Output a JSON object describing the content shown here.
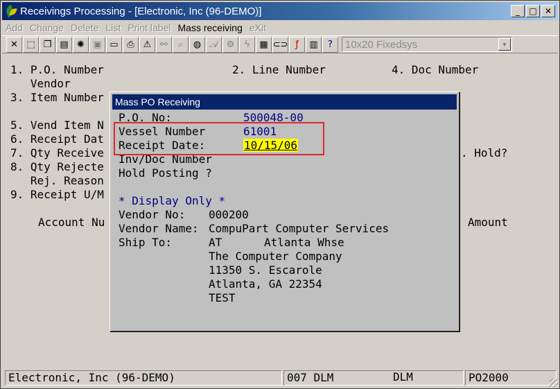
{
  "window": {
    "title": "Receivings Processing - [Electronic, Inc (96-DEMO)]",
    "buttons": {
      "minimize": "_",
      "maximize": "□",
      "close": "✕"
    }
  },
  "menu": {
    "items": [
      {
        "label": "Add",
        "enabled": false
      },
      {
        "label": "Change",
        "enabled": false
      },
      {
        "label": "Delete",
        "enabled": false
      },
      {
        "label": "List",
        "enabled": false
      },
      {
        "label": "Print label",
        "enabled": false
      },
      {
        "label": "Mass receiving",
        "enabled": true
      },
      {
        "label": "eXit",
        "enabled": false
      }
    ]
  },
  "toolbar": {
    "font_selector": "10x20 Fixedsys"
  },
  "screen": {
    "l1a": "1. P.O. Number",
    "l1b": "2. Line Number",
    "l1c": "4. Doc Number",
    "l2": "   Vendor",
    "l3": "3. Item Number",
    "l5": "5. Vend Item N",
    "l6": "6. Receipt Dat",
    "l7": "7. Qty Receive",
    "l7r": ". Hold?",
    "l8": "8. Qty Rejecte",
    "l8b": "   Rej. Reason",
    "l9": "9. Receipt U/M",
    "acct": "Account Nu",
    "amount": "Amount"
  },
  "dialog": {
    "title": "Mass PO Receiving",
    "po_label": "P.O. No:",
    "po_value": "500048-00",
    "vessel_label": "Vessel Number",
    "vessel_value": "61001",
    "receipt_label": "Receipt Date:",
    "receipt_value": "10/15/06",
    "inv_label": "Inv/Doc Number",
    "hold_label": "Hold Posting ?",
    "display_only": "* Display Only *",
    "vendor_no_label": "Vendor No:",
    "vendor_no_value": "000200",
    "vendor_name_label": "Vendor Name:",
    "vendor_name_value": "CompuPart Computer Services",
    "ship_to_label": "Ship To:",
    "ship_code": "AT",
    "ship_name": "Atlanta Whse",
    "ship_line1": "The Computer Company",
    "ship_line2": "11350 S. Escarole",
    "ship_line3": "Atlanta, GA 22354",
    "ship_line4": "TEST"
  },
  "status": {
    "company": "Electronic, Inc (96-DEMO)",
    "user_code": "007 DLM",
    "user": "DLM",
    "program": "PO2000"
  },
  "colors": {
    "titlebar": "#0a246a",
    "dialog_title": "#0a246a",
    "highlight": "#ffff00",
    "annotation_box": "#e0262b",
    "text_blue": "#000080"
  }
}
